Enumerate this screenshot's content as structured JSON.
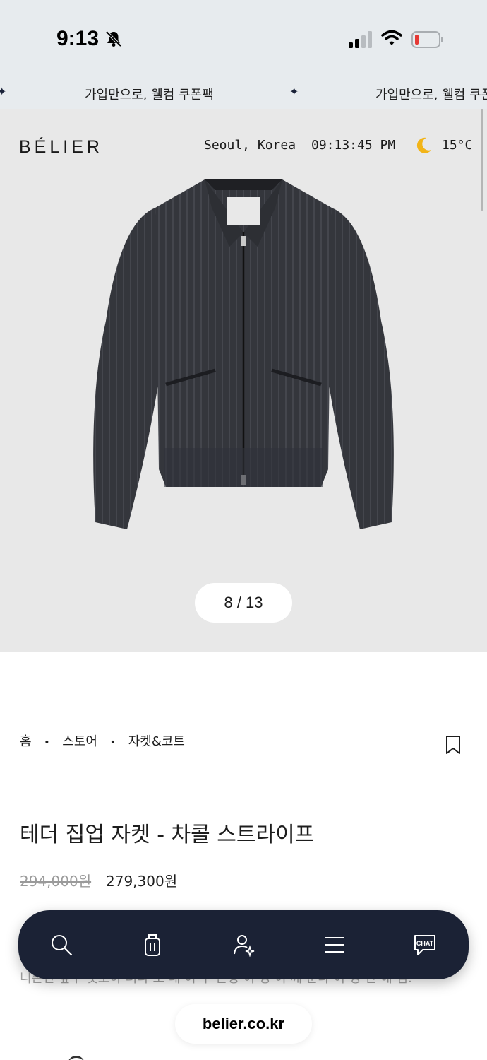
{
  "status_bar": {
    "time": "9:13",
    "battery_color": "#e53935"
  },
  "promo": {
    "text": "가입만으로, 웰컴 쿠폰팩",
    "text_cut": "가입만으로, 웰컴 쿠폰"
  },
  "header": {
    "logo": "BÉLIER",
    "location": "Seoul, Korea",
    "clock": "09:13:45 PM",
    "temperature": "15°C"
  },
  "gallery": {
    "counter": "8 / 13"
  },
  "breadcrumb": {
    "home": "홈",
    "store": "스토어",
    "category": "자켓&코트"
  },
  "product": {
    "title": "테더 집업 자켓 - 차콜 스트라이프",
    "original_price": "294,000원",
    "sale_price": "279,300원"
  },
  "description": {
    "partial_line": "니폰한 앞두 깃호하 려다 도 레 이 수 든형 이 성 이 깨 둔다 이 성 난 해 임."
  },
  "bottom_nav": {
    "items": [
      {
        "icon": "search-icon"
      },
      {
        "icon": "cart-icon"
      },
      {
        "icon": "account-icon"
      },
      {
        "icon": "menu-icon"
      },
      {
        "icon": "chat-icon",
        "label": "CHAT"
      }
    ],
    "background": "#1b2235"
  },
  "browser": {
    "url": "belier.co.kr"
  }
}
